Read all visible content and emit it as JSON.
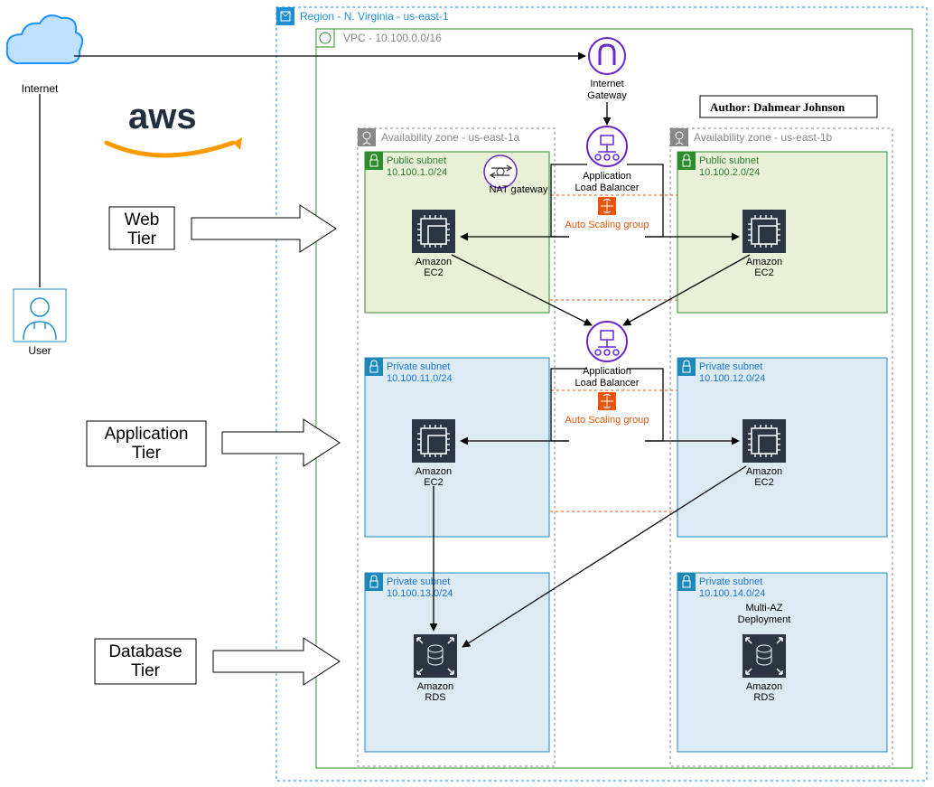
{
  "user_label": "User",
  "internet_label": "Internet",
  "aws_label": "aws",
  "region_label": "Region - N. Virginia - us-east-1",
  "vpc_label": "VPC - 10.100.0.0/16",
  "igw_label1": "Internet",
  "igw_label2": "Gateway",
  "alb_label1": "Application",
  "alb_label2": "Load Balancer",
  "asg_label": "Auto Scaling group",
  "nat_label": "NAT gateway",
  "az_a_label": "Availability zone - us-east-1a",
  "az_b_label": "Availability zone - us-east-1b",
  "pub_subnet_label": "Public subnet",
  "pub_a_cidr": "10.100.1.0/24",
  "pub_b_cidr": "10.100.2.0/24",
  "priv_subnet_label": "Private subnet",
  "priv_a1_cidr": "10.100.11.0/24",
  "priv_b1_cidr": "10.100.12.0/24",
  "priv_a2_cidr": "10.100.13.0/24",
  "priv_b2_cidr": "10.100.14.0/24",
  "ec2_label1": "Amazon",
  "ec2_label2": "EC2",
  "rds_label1": "Amazon",
  "rds_label2": "RDS",
  "multiaz_l1": "Multi-AZ",
  "multiaz_l2": "Deployment",
  "author_label": "Author: Dahmear Johnson",
  "tier_web": "Web Tier",
  "tier_app": "Application Tier",
  "tier_db": "Database Tier"
}
